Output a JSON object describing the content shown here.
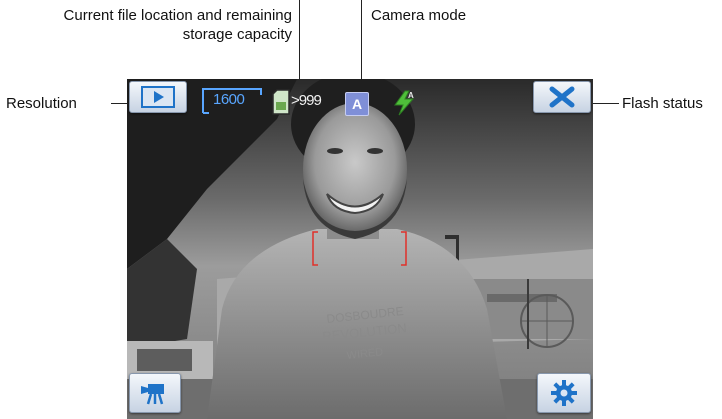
{
  "callouts": {
    "file_location_line1": "Current file location and remaining",
    "file_location_line2": "storage capacity",
    "camera_mode": "Camera mode",
    "resolution": "Resolution",
    "flash_status": "Flash status"
  },
  "toolbar": {
    "resolution_value": "1600",
    "storage_remaining": ">999",
    "camera_mode_letter": "A"
  },
  "icons": {
    "playback": "playback-icon",
    "close": "close-icon",
    "video_mode": "video-camera-icon",
    "settings": "gear-icon",
    "storage": "memory-card-icon",
    "flash": "flash-auto-icon"
  },
  "colors": {
    "accent_blue": "#1f73c8",
    "resolution_blue": "#59a6ff",
    "flash_green": "#4fbf3a",
    "focus_red": "#e0302a",
    "mode_badge": "#7f8fd7"
  }
}
